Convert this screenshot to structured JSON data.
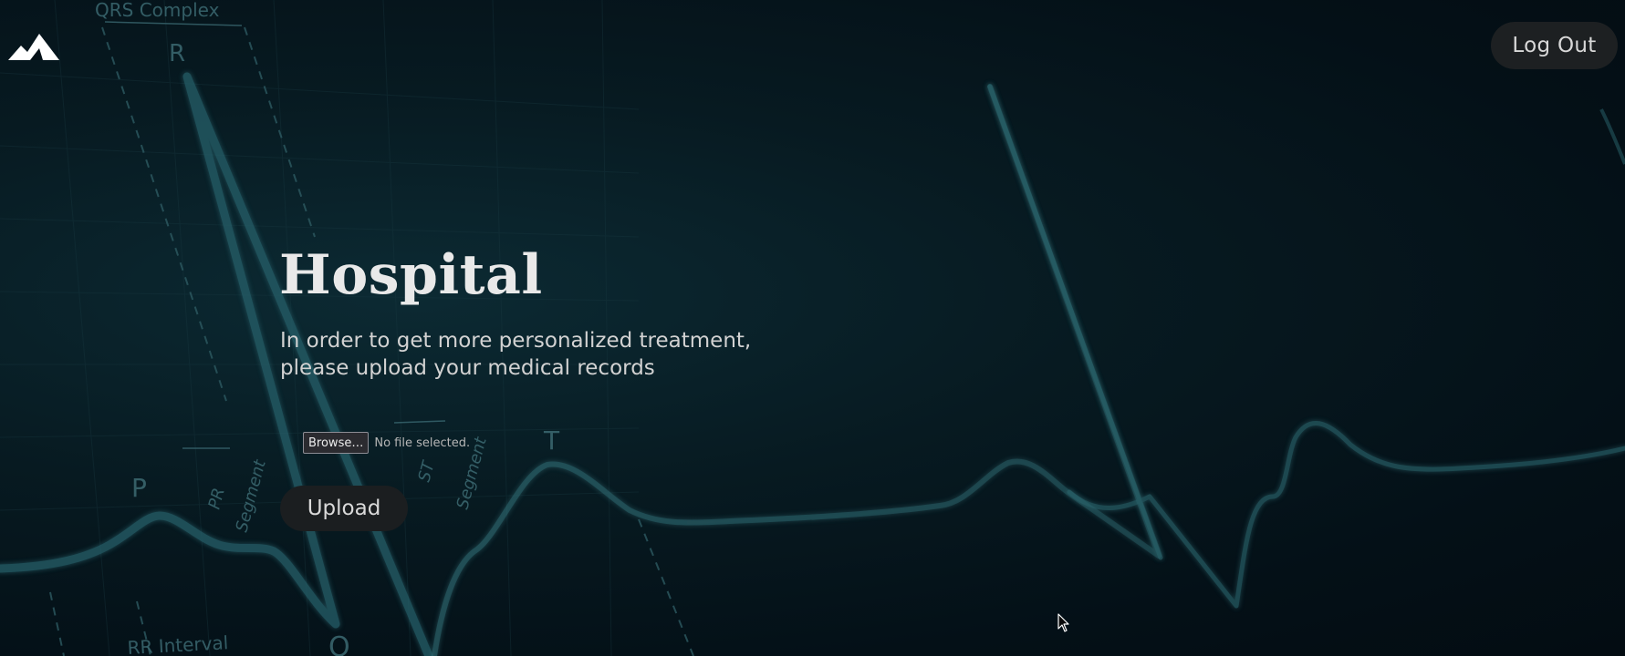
{
  "header": {
    "logo_icon": "mountain-logo-icon",
    "logout_label": "Log Out"
  },
  "hero": {
    "title": "Hospital",
    "subtitle_line1": "In order to get more personalized treatment,",
    "subtitle_line2": "please upload your medical records"
  },
  "upload_form": {
    "browse_label": "Browse…",
    "file_status": "No file selected.",
    "upload_label": "Upload"
  },
  "background_labels": {
    "qrs_complex": "QRS Complex",
    "r": "R",
    "p": "P",
    "t": "T",
    "q": "Q",
    "pr_segment_line1": "PR",
    "pr_segment_line2": "Segment",
    "st_segment_line1": "ST",
    "st_segment_line2": "Segment",
    "rr_interval": "RR Interval"
  },
  "colors": {
    "background": "#041017",
    "ecg_line": "#2c6b72",
    "button_bg": "#1d2022",
    "title_text": "#e9e9e9"
  }
}
